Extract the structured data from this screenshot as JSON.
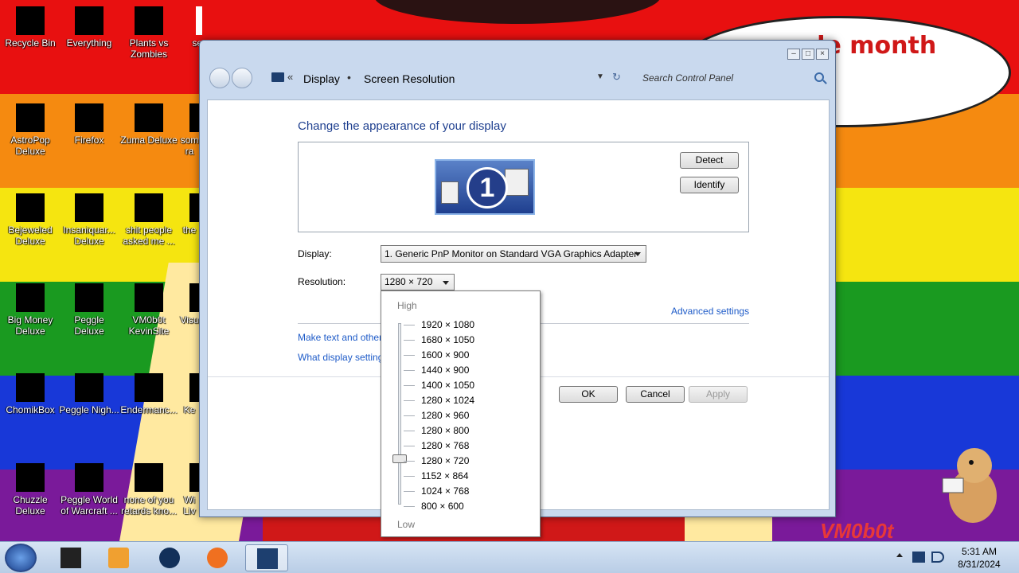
{
  "desktop": {
    "speech_text": "de month",
    "watermark": "VM0b0t",
    "icons": [
      {
        "label": "Recycle Bin"
      },
      {
        "label": "Everything"
      },
      {
        "label": "Plants vs Zombies"
      },
      {
        "label": "se"
      },
      {
        "label": "AstroPop Deluxe"
      },
      {
        "label": "Firefox"
      },
      {
        "label": "Zuma Deluxe"
      },
      {
        "label": "som ra"
      },
      {
        "label": "Bejeweled Deluxe"
      },
      {
        "label": "Insaniquar... Deluxe"
      },
      {
        "label": "shit people asked me ..."
      },
      {
        "label": "the"
      },
      {
        "label": "Big Money Deluxe"
      },
      {
        "label": "Peggle Deluxe"
      },
      {
        "label": "VM0b0t KevinSite"
      },
      {
        "label": "Visu"
      },
      {
        "label": "ChomikBox"
      },
      {
        "label": "Peggle Nigh..."
      },
      {
        "label": "Endermanc..."
      },
      {
        "label": "Ke"
      },
      {
        "label": "Chuzzle Deluxe"
      },
      {
        "label": "Peggle World of Warcraft ..."
      },
      {
        "label": "none of you retards kno..."
      },
      {
        "label": "Wi Liv"
      }
    ]
  },
  "window": {
    "breadcrumb": [
      "Display",
      "Screen Resolution"
    ],
    "crumb_chevron": "«",
    "crumb_separator": "•",
    "search_placeholder": "Search Control Panel",
    "heading": "Change the appearance of your display",
    "monitor_number": "1",
    "detect_label": "Detect",
    "identify_label": "Identify",
    "display_label": "Display:",
    "display_value": "1. Generic PnP Monitor on Standard VGA Graphics Adapter",
    "resolution_label": "Resolution:",
    "resolution_value": "1280 × 720",
    "advanced_link": "Advanced settings",
    "link_text_size": "Make text and other",
    "link_display_settings": "What display setting",
    "ok_label": "OK",
    "cancel_label": "Cancel",
    "apply_label": "Apply"
  },
  "dropdown": {
    "high_label": "High",
    "low_label": "Low",
    "selected": "1280 × 720",
    "options": [
      "1920 × 1080",
      "1680 × 1050",
      "1600 × 900",
      "1440 × 900",
      "1400 × 1050",
      "1280 × 1024",
      "1280 × 960",
      "1280 × 800",
      "1280 × 768",
      "1280 × 720",
      "1152 × 864",
      "1024 × 768",
      "800 × 600"
    ]
  },
  "taskbar": {
    "time": "5:31 AM",
    "date": "8/31/2024"
  },
  "colors": {
    "link": "#1e5bc8",
    "heading": "#1e3f8f"
  }
}
